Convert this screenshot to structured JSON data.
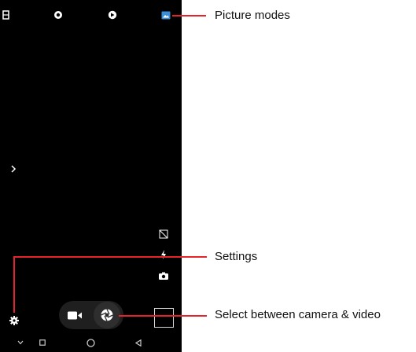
{
  "callouts": {
    "picture_modes": "Picture modes",
    "settings": "Settings",
    "select_mode": "Select between camera & video"
  },
  "colors": {
    "annotation": "#e5232b",
    "screen_bg": "#000000",
    "accent_blue": "#3b8fd6",
    "icon": "#ffffff"
  },
  "icons": {
    "top": [
      "aspect-ratio-icon",
      "timer-icon",
      "filter-icon",
      "picture-mode-icon"
    ],
    "side": [
      "chevron-right-icon",
      "hdr-off-icon",
      "flash-icon",
      "switch-camera-icon",
      "settings-gear-icon"
    ],
    "mode_switch": [
      "video-camera-icon",
      "shutter-icon"
    ],
    "nav": [
      "chevron-down-icon",
      "recent-apps-icon",
      "home-icon",
      "back-icon"
    ]
  }
}
